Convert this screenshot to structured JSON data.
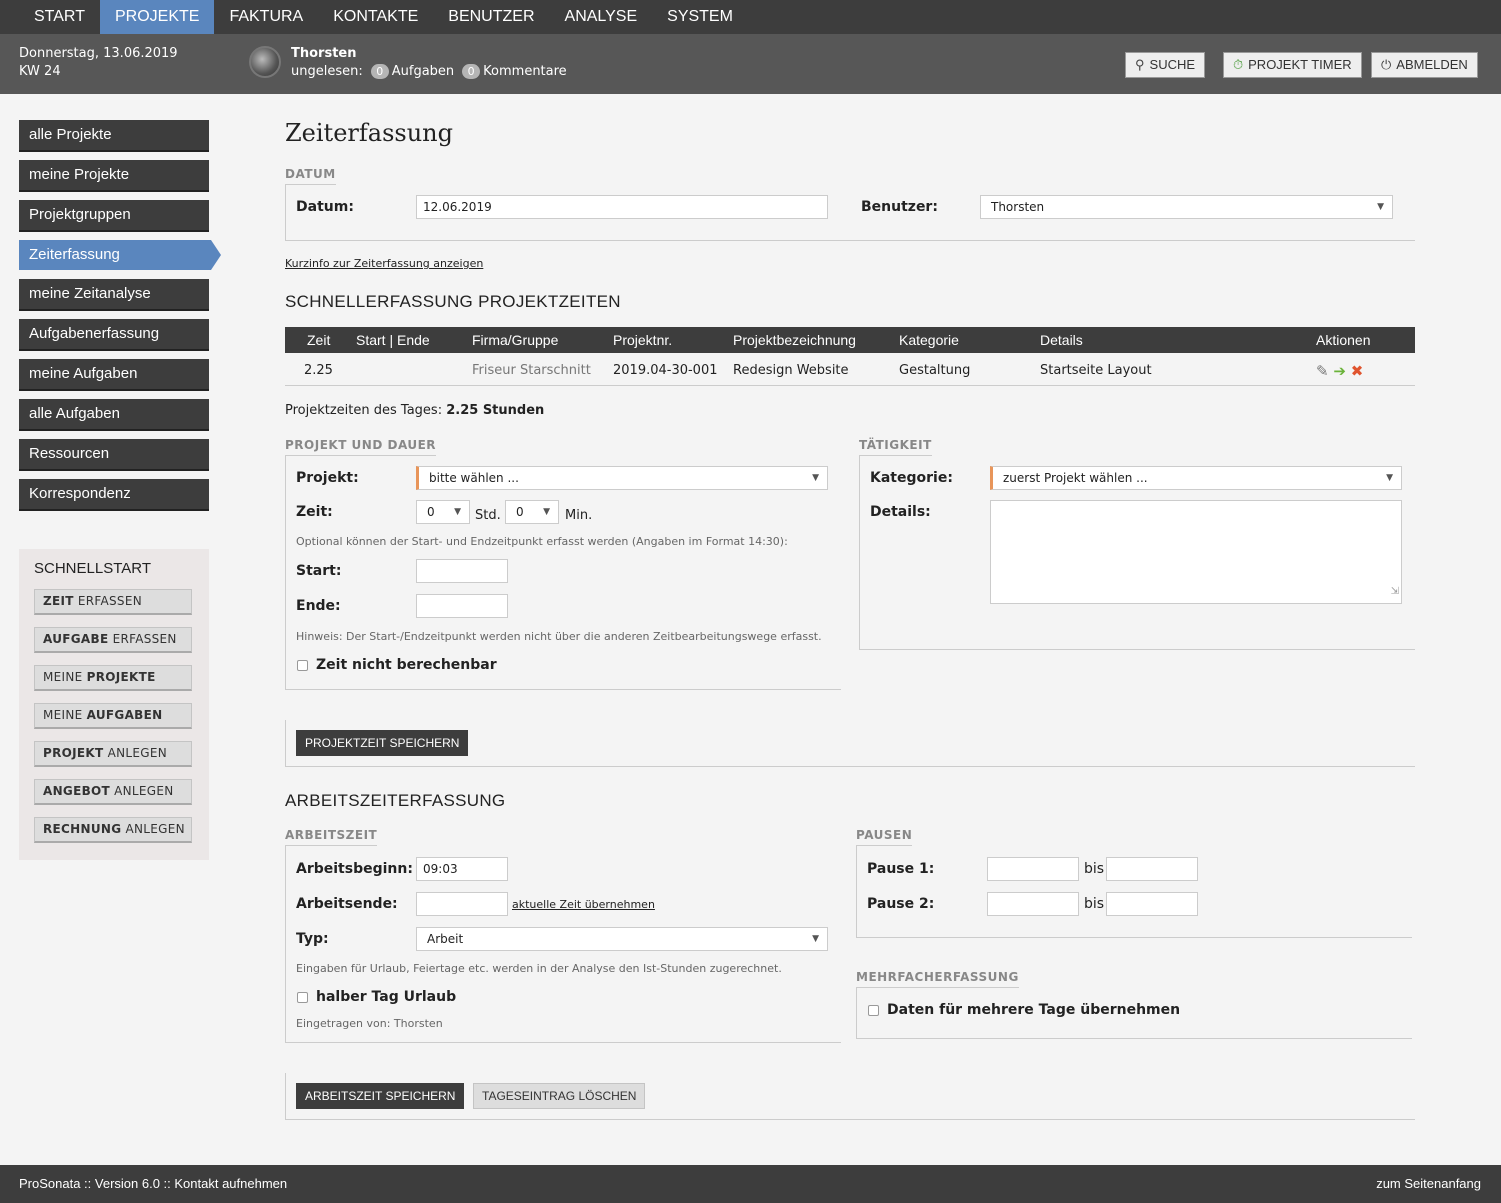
{
  "nav": [
    "START",
    "PROJEKTE",
    "FAKTURA",
    "KONTAKTE",
    "BENUTZER",
    "ANALYSE",
    "SYSTEM"
  ],
  "header": {
    "date": "Donnerstag, 13.06.2019",
    "week": "KW 24",
    "user_name": "Thorsten",
    "unread_label": "ungelesen:",
    "tasks_count": "0",
    "tasks_label": "Aufgaben",
    "comments_count": "0",
    "comments_label": "Kommentare",
    "search_label": "SUCHE",
    "timer_label": "PROJEKT TIMER",
    "logout_label": "ABMELDEN"
  },
  "sidebar": [
    "alle Projekte",
    "meine Projekte",
    "Projektgruppen",
    "Zeiterfassung",
    "meine Zeitanalyse",
    "Aufgabenerfassung",
    "meine Aufgaben",
    "alle Aufgaben",
    "Ressourcen",
    "Korrespondenz"
  ],
  "quickstart": {
    "title": "SCHNELLSTART",
    "buttons": [
      {
        "bold": "ZEIT",
        "rest": " ERFASSEN",
        "order": "bold-first"
      },
      {
        "bold": "AUFGABE",
        "rest": " ERFASSEN",
        "order": "bold-first"
      },
      {
        "bold": "PROJEKTE",
        "rest": "MEINE ",
        "order": "rest-first"
      },
      {
        "bold": "AUFGABEN",
        "rest": "MEINE ",
        "order": "rest-first"
      },
      {
        "bold": "PROJEKT",
        "rest": " ANLEGEN",
        "order": "bold-first"
      },
      {
        "bold": "ANGEBOT",
        "rest": " ANLEGEN",
        "order": "bold-first"
      },
      {
        "bold": "RECHNUNG",
        "rest": " ANLEGEN",
        "order": "bold-first"
      }
    ]
  },
  "page": {
    "title": "Zeiterfassung",
    "datum_section": "DATUM",
    "datum_label": "Datum:",
    "datum_value": "12.06.2019",
    "benutzer_label": "Benutzer:",
    "benutzer_value": "Thorsten",
    "kurzinfo_link": "Kurzinfo zur Zeiterfassung anzeigen",
    "schnell_heading": "SCHNELLERFASSUNG PROJEKTZEITEN"
  },
  "table": {
    "headers": [
      "Zeit",
      "Start | Ende",
      "Firma/Gruppe",
      "Projektnr.",
      "Projektbezeichnung",
      "Kategorie",
      "Details",
      "Aktionen"
    ],
    "row": {
      "zeit": "2.25",
      "start_ende": "",
      "firma": "Friseur Starschnitt",
      "projektnr": "2019.04-30-001",
      "bezeichnung": "Redesign Website",
      "kategorie": "Gestaltung",
      "details": "Startseite Layout"
    },
    "total_label": "Projektzeiten des Tages:",
    "total_value": "2.25 Stunden"
  },
  "projekt_form": {
    "section": "PROJEKT UND DAUER",
    "projekt_label": "Projekt:",
    "projekt_value": "bitte wählen ...",
    "zeit_label": "Zeit:",
    "hours_value": "0",
    "hours_unit": "Std.",
    "min_value": "0",
    "min_unit": "Min.",
    "optional_hint": "Optional können der Start- und Endzeitpunkt erfasst werden (Angaben im Format 14:30):",
    "start_label": "Start:",
    "ende_label": "Ende:",
    "hinweis": "Hinweis: Der Start-/Endzeitpunkt werden nicht über die anderen Zeitbearbeitungswege erfasst.",
    "nicht_berechenbar_label": "Zeit nicht berechenbar",
    "save_label": "PROJEKTZEIT SPEICHERN"
  },
  "taetigkeit": {
    "section": "TÄTIGKEIT",
    "kategorie_label": "Kategorie:",
    "kategorie_value": "zuerst Projekt wählen ...",
    "details_label": "Details:"
  },
  "arbeitszeit": {
    "heading": "ARBEITSZEITERFASSUNG",
    "section": "ARBEITSZEIT",
    "beginn_label": "Arbeitsbeginn:",
    "beginn_value": "09:03",
    "ende_label": "Arbeitsende:",
    "aktuelle_zeit_link": "aktuelle Zeit übernehmen",
    "typ_label": "Typ:",
    "typ_value": "Arbeit",
    "urlaub_hint": "Eingaben für Urlaub, Feiertage etc. werden in der Analyse den Ist-Stunden zugerechnet.",
    "halber_tag_label": "halber Tag Urlaub",
    "eingetragen": "Eingetragen von: Thorsten",
    "save_label": "ARBEITSZEIT SPEICHERN",
    "delete_label": "TAGESEINTRAG LÖSCHEN"
  },
  "pausen": {
    "section": "PAUSEN",
    "pause1_label": "Pause 1:",
    "pause2_label": "Pause 2:",
    "bis_label": "bis"
  },
  "mehrfach": {
    "section": "MEHRFACHERFASSUNG",
    "label": "Daten für mehrere Tage übernehmen"
  },
  "footer": {
    "left": "ProSonata :: Version 6.0 :: Kontakt aufnehmen",
    "right": "zum Seitenanfang"
  },
  "colors": {
    "accent": "#5a86be",
    "dark": "#3d3d3d",
    "required_marker": "#e8955a"
  }
}
